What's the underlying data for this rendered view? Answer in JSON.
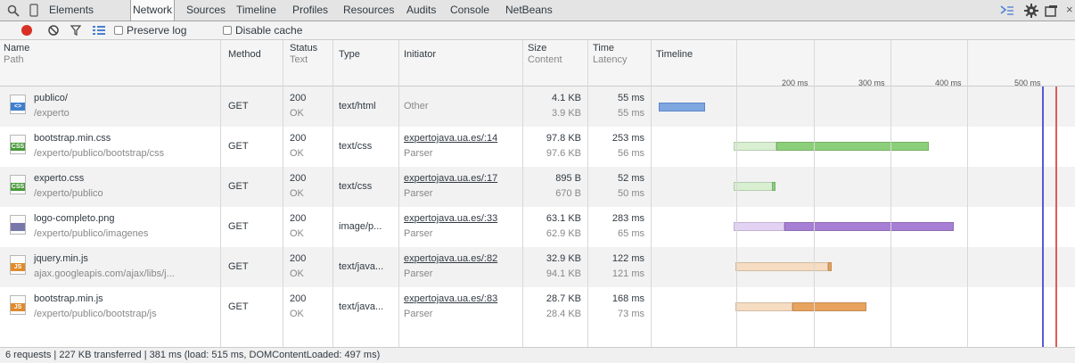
{
  "tabs": [
    "Elements",
    "Network",
    "Sources",
    "Timeline",
    "Profiles",
    "Resources",
    "Audits",
    "Console",
    "NetBeans"
  ],
  "active_tab": "Network",
  "toolbar": {
    "preserve_log": "Preserve log",
    "disable_cache": "Disable cache"
  },
  "headers": {
    "name": "Name",
    "path": "Path",
    "method": "Method",
    "status": "Status",
    "status_text": "Text",
    "type": "Type",
    "initiator": "Initiator",
    "size": "Size",
    "content": "Content",
    "time": "Time",
    "latency": "Latency",
    "timeline": "Timeline"
  },
  "ticks": [
    "200 ms",
    "300 ms",
    "400 ms",
    "500 ms"
  ],
  "rows": [
    {
      "name": "publico/",
      "path": "/experto",
      "method": "GET",
      "status": "200",
      "status_text": "OK",
      "type": "text/html",
      "initiator": "Other",
      "initiator_sub": "",
      "size": "4.1 KB",
      "content": "3.9 KB",
      "time": "55 ms",
      "latency": "55 ms",
      "icon": "html-file-icon",
      "tag": "<>"
    },
    {
      "name": "bootstrap.min.css",
      "path": "/experto/publico/bootstrap/css",
      "method": "GET",
      "status": "200",
      "status_text": "OK",
      "type": "text/css",
      "initiator": "expertojava.ua.es/:14",
      "initiator_sub": "Parser",
      "size": "97.8 KB",
      "content": "97.6 KB",
      "time": "253 ms",
      "latency": "56 ms",
      "icon": "css-file-icon",
      "tag": "CSS"
    },
    {
      "name": "experto.css",
      "path": "/experto/publico",
      "method": "GET",
      "status": "200",
      "status_text": "OK",
      "type": "text/css",
      "initiator": "expertojava.ua.es/:17",
      "initiator_sub": "Parser",
      "size": "895 B",
      "content": "670 B",
      "time": "52 ms",
      "latency": "50 ms",
      "icon": "css-file-icon",
      "tag": "CSS"
    },
    {
      "name": "logo-completo.png",
      "path": "/experto/publico/imagenes",
      "method": "GET",
      "status": "200",
      "status_text": "OK",
      "type": "image/p...",
      "initiator": "expertojava.ua.es/:33",
      "initiator_sub": "Parser",
      "size": "63.1 KB",
      "content": "62.9 KB",
      "time": "283 ms",
      "latency": "65 ms",
      "icon": "image-file-icon",
      "tag": ""
    },
    {
      "name": "jquery.min.js",
      "path": "ajax.googleapis.com/ajax/libs/j...",
      "method": "GET",
      "status": "200",
      "status_text": "OK",
      "type": "text/java...",
      "initiator": "expertojava.ua.es/:82",
      "initiator_sub": "Parser",
      "size": "32.9 KB",
      "content": "94.1 KB",
      "time": "122 ms",
      "latency": "121 ms",
      "icon": "js-file-icon",
      "tag": "JS"
    },
    {
      "name": "bootstrap.min.js",
      "path": "/experto/publico/bootstrap/js",
      "method": "GET",
      "status": "200",
      "status_text": "OK",
      "type": "text/java...",
      "initiator": "expertojava.ua.es/:83",
      "initiator_sub": "Parser",
      "size": "28.7 KB",
      "content": "28.4 KB",
      "time": "168 ms",
      "latency": "73 ms",
      "icon": "js-file-icon",
      "tag": "JS"
    }
  ],
  "status_bar": "6 requests | 227 KB transferred | 381 ms (load: 515 ms, DOMContentLoaded: 497 ms)",
  "colors": {
    "html": "#7fa7e0",
    "css": "#8ccf7a",
    "image": "#a77fd4",
    "js": "#e8a35e",
    "dom_line": "#5a5ad8",
    "load_line": "#e05a5a"
  }
}
